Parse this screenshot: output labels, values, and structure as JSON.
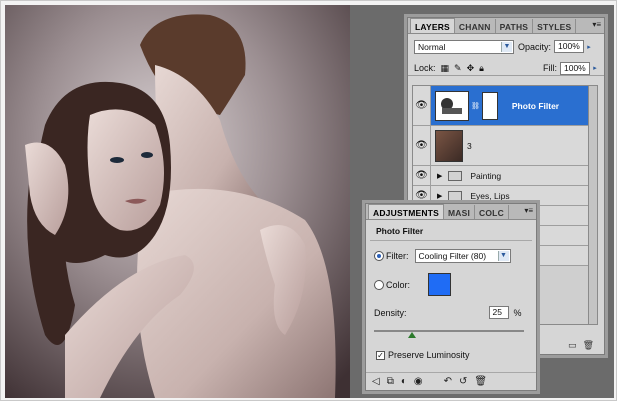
{
  "layers_panel": {
    "tabs": [
      "LAYERS",
      "CHANN",
      "PATHS",
      "STYLES"
    ],
    "blend_mode": "Normal",
    "opacity_label": "Opacity:",
    "opacity_value": "100%",
    "lock_label": "Lock:",
    "fill_label": "Fill:",
    "fill_value": "100%",
    "layers": [
      {
        "name": "Photo Filter",
        "selected": true,
        "type": "adjustment"
      },
      {
        "name": "3",
        "selected": false,
        "type": "image"
      },
      {
        "name": "Painting",
        "selected": false,
        "type": "group"
      },
      {
        "name": "Eyes, Lips",
        "selected": false,
        "type": "group"
      }
    ]
  },
  "adjustments_panel": {
    "tabs": [
      "ADJUSTMENTS",
      "MASI",
      "COLC"
    ],
    "title": "Photo Filter",
    "filter_label": "Filter:",
    "filter_value": "Cooling Filter (80)",
    "color_label": "Color:",
    "color_swatch": "#1f6cf5",
    "density_label": "Density:",
    "density_value": "25",
    "density_unit": "%",
    "density_level": 0.25,
    "preserve_label": "Preserve Luminosity",
    "preserve_checked": true
  },
  "colors": {
    "selection_blue": "#2a6fd0",
    "panel_gray": "#d6d6d6",
    "workspace_gray": "#6b6b6b"
  }
}
